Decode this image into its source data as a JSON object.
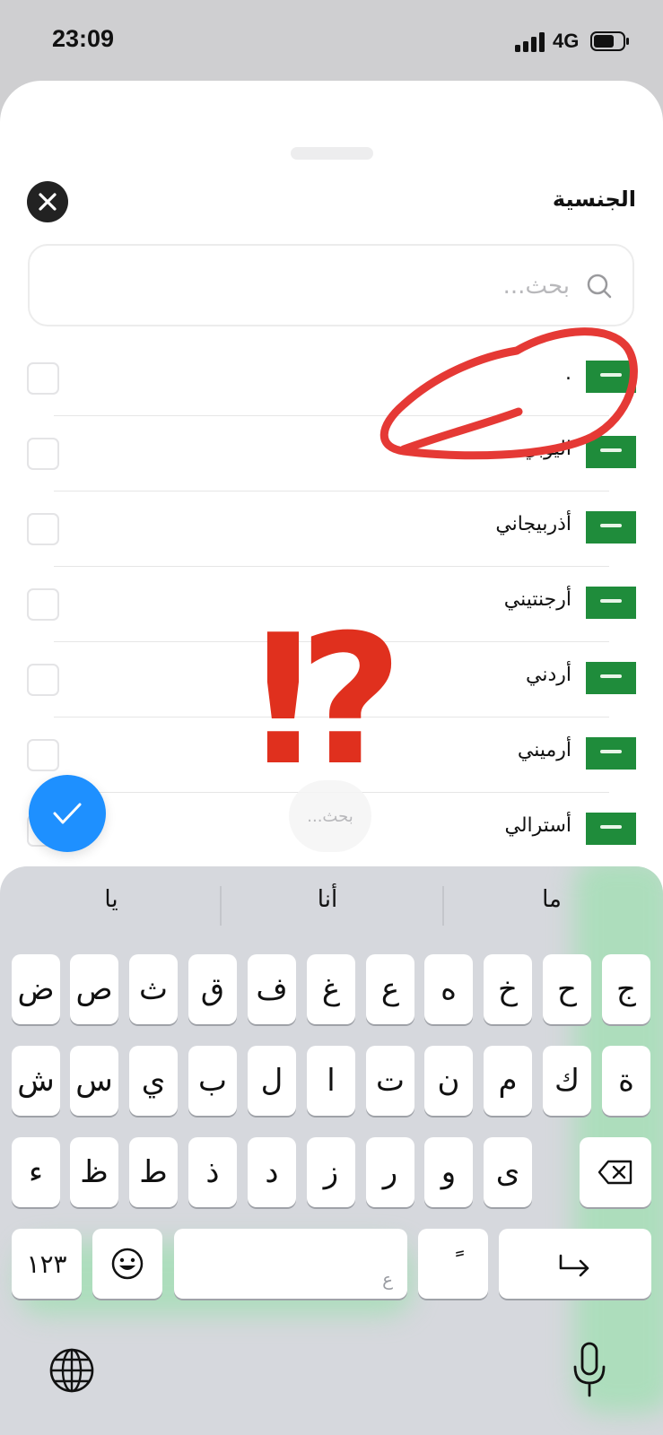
{
  "status_bar": {
    "time": "23:09",
    "network": "4G"
  },
  "sheet": {
    "title": "الجنسية",
    "search_placeholder": "بحث..."
  },
  "nationalities": [
    {
      "label": "."
    },
    {
      "label": "اليوبي"
    },
    {
      "label": "أذربيجاني"
    },
    {
      "label": "أرجنتيني"
    },
    {
      "label": "أردني"
    },
    {
      "label": "أرميني"
    },
    {
      "label": "أسترالي"
    }
  ],
  "ghost_search_label": "بحث...",
  "annotation_mark": "⁉",
  "keyboard": {
    "suggestions": [
      "ما",
      "أنا",
      "يا"
    ],
    "row1": [
      "ج",
      "ح",
      "خ",
      "ه",
      "ع",
      "غ",
      "ف",
      "ق",
      "ث",
      "ص",
      "ض"
    ],
    "row2": [
      "ة",
      "ك",
      "م",
      "ن",
      "ت",
      "ا",
      "ل",
      "ب",
      "ي",
      "س",
      "ش"
    ],
    "row3": [
      "ى",
      "و",
      "ر",
      "ز",
      "د",
      "ذ",
      "ط",
      "ظ",
      "ء"
    ],
    "numbers_key": "١٢٣",
    "space_hint": "ع",
    "diacritic_key": "ً"
  },
  "colors": {
    "accent": "#1e90ff",
    "flag_green": "#1f8c3b",
    "annotation_red": "#e53935"
  },
  "icons": [
    "close-icon",
    "search-icon",
    "check-icon",
    "emoji-icon",
    "backspace-icon",
    "return-icon",
    "globe-icon",
    "microphone-icon"
  ]
}
